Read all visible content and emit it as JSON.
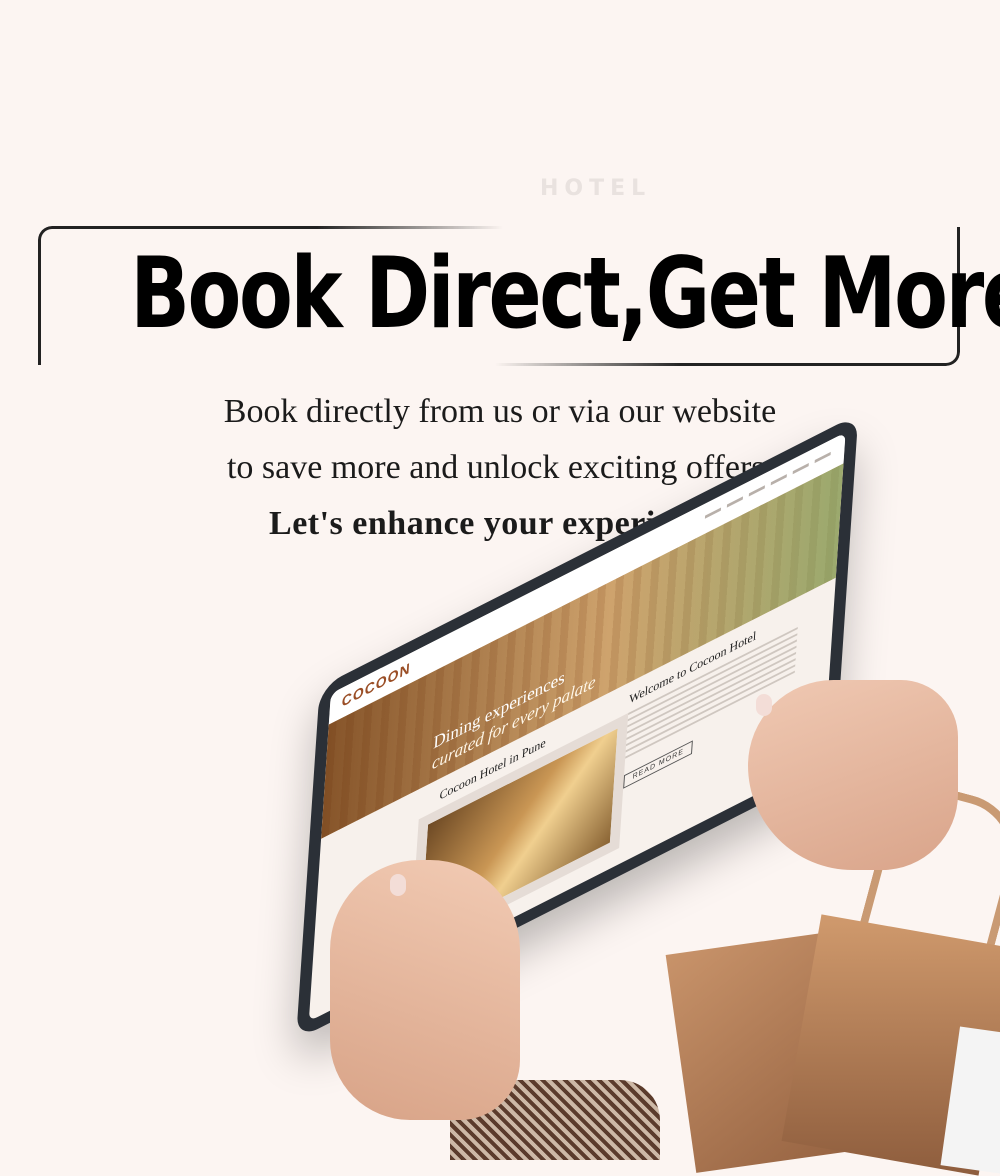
{
  "ghost_text": "HOTEL",
  "headline": "Book Direct,Get More",
  "subtext": {
    "line1": "Book directly from us or via our website",
    "line2": "to save more and unlock exciting offers.",
    "line3": "Let's enhance your experience."
  },
  "tablet_screen": {
    "logo": "COCOON",
    "hero_line1": "Dining experiences",
    "hero_line2": "curated for every palate",
    "section_left": "Cocoon Hotel in Pune",
    "section_right": "Welcome to Cocoon Hotel",
    "button": "READ MORE"
  },
  "colors": {
    "background": "#fcf5f2",
    "headline": "#000000",
    "brand_accent": "#9a4e26"
  }
}
